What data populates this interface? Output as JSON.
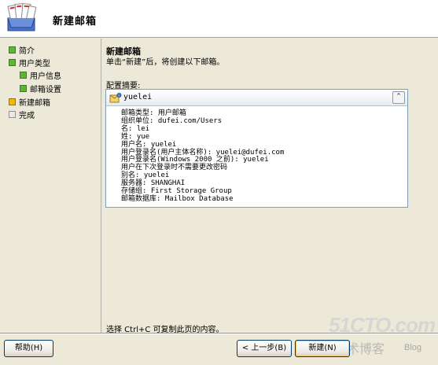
{
  "header": {
    "title": "新建邮箱",
    "icon": "mailbox-wizard-icon"
  },
  "nav": {
    "items": [
      {
        "label": "简介",
        "status": "done"
      },
      {
        "label": "用户类型",
        "status": "done"
      },
      {
        "label": "用户信息",
        "status": "done"
      },
      {
        "label": "邮箱设置",
        "status": "done"
      },
      {
        "label": "新建邮箱",
        "status": "current"
      },
      {
        "label": "完成",
        "status": "pending"
      }
    ]
  },
  "content": {
    "title": "新建邮箱",
    "description": "单击“新建”后，将创建以下邮箱。",
    "summary_label": "配置摘要:",
    "summary": {
      "name": "yuelei",
      "lines": [
        "邮箱类型: 用户邮箱",
        "组织单位: dufei.com/Users",
        "名: lei",
        "姓: yue",
        "用户名: yuelei",
        "用户登录名(用户主体名称): yuelei@dufei.com",
        "用户登录名(Windows 2000 之前): yuelei",
        "用户在下次登录时不需要更改密码",
        "别名: yuelei",
        "服务器: SHANGHAI",
        "存储组: First Storage Group",
        "邮箱数据库: Mailbox Database"
      ]
    },
    "copy_hint": "选择 Ctrl+C 可复制此页的内容。"
  },
  "footer": {
    "help": "帮助(H)",
    "back": "< 上一步(B)",
    "new": "新建(N)"
  },
  "watermark": {
    "site": "51CTO.com",
    "blog_cn": "技术博客",
    "blog": "Blog"
  },
  "colors": {
    "done": "#5fb535",
    "current": "#f0b800",
    "pending": "#e8e8e8"
  }
}
